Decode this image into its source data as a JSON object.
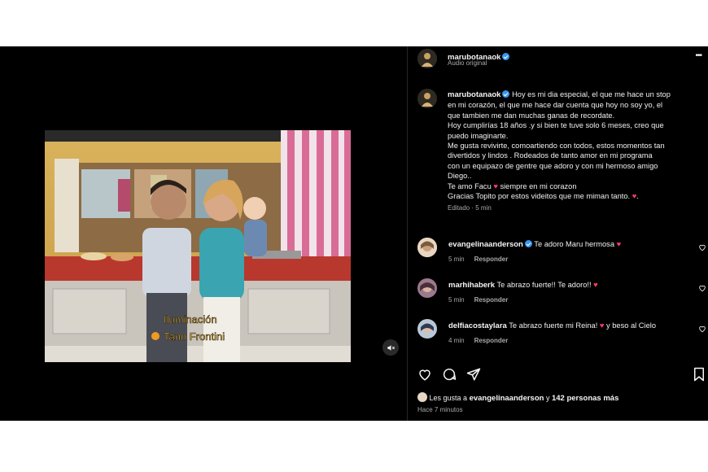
{
  "video": {
    "overlay_line1": "Iluminación",
    "overlay_line2": "Tano Frontini"
  },
  "header": {
    "username": "marubotanaok",
    "subtitle": "Audio original",
    "more": "•••"
  },
  "caption": {
    "username": "marubotanaok",
    "text_line1": "Hoy es mi dia especial, el que me hace un stop",
    "text_line2": "en mi corazón, el que me hace dar cuenta que hoy no soy yo, el",
    "text_line3": "que tambien me dan muchas ganas de recordate.",
    "text_line4": "Hoy cumplirías 18 años .y si bien te tuve solo 6 meses, creo que",
    "text_line5": "puedo imaginarte.",
    "text_line6": "Me gusta revivirte, comoartiendo con todos, estos momentos tan",
    "text_line7": "divertidos y lindos . Rodeados de tanto amor en mi programa",
    "text_line8": "con un equipazo de gentre que adoro y con mi hermoso amigo",
    "text_line9": "Diego..",
    "text_line10a": "Te amo Facu",
    "text_line10b": "siempre en mi corazon",
    "text_line11": "Gracias Topito por estos videitos que me miman tanto.",
    "edited": "Editado · 5 min"
  },
  "comments": [
    {
      "username": "evangelinaanderson",
      "text": "Te adoro Maru hermosa",
      "time": "5 min",
      "reply": "Responder"
    },
    {
      "username": "marhihaberk",
      "text": "Te abrazo fuerte!! Te adoro!!",
      "time": "5 min",
      "reply": "Responder"
    },
    {
      "username": "delfiacostaylara",
      "text": "Te abrazo fuerte mi Reina!",
      "text_after": "y beso al Cielo",
      "time": "4 min",
      "reply": "Responder"
    }
  ],
  "likes": {
    "prefix": "Les gusta a",
    "user": "evangelinaanderson",
    "middle": "y",
    "count": "142 personas más"
  },
  "posted": "Hace 7 minutos",
  "colors": {
    "background": "#000000",
    "verified": "#3897f0",
    "heart": "#ff3b6b",
    "muted_text": "#a8a8a8"
  },
  "icons": [
    "heart-icon",
    "comment-icon",
    "share-icon",
    "bookmark-icon",
    "mute-icon",
    "more-icon",
    "verified-icon"
  ]
}
